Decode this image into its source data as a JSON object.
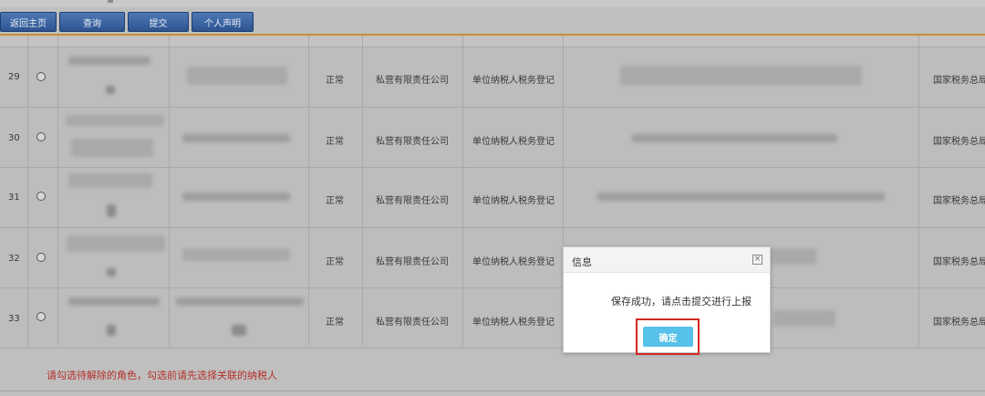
{
  "toolbar": {
    "home_label": "返回主页",
    "query_label": "查询",
    "submit_label": "提交",
    "declaration_label": "个人声明"
  },
  "table": {
    "rows": [
      {
        "no": "29",
        "status": "正常",
        "type": "私营有限责任公司",
        "registration": "单位纳税人税务登记",
        "authority": "国家税务总局"
      },
      {
        "no": "30",
        "status": "正常",
        "type": "私营有限责任公司",
        "registration": "单位纳税人税务登记",
        "authority": "国家税务总局"
      },
      {
        "no": "31",
        "status": "正常",
        "type": "私营有限责任公司",
        "registration": "单位纳税人税务登记",
        "authority": "国家税务总局"
      },
      {
        "no": "32",
        "status": "正常",
        "type": "私营有限责任公司",
        "registration": "单位纳税人税务登记",
        "authority": "国家税务总局"
      },
      {
        "no": "33",
        "status": "正常",
        "type": "私营有限责任公司",
        "registration": "单位纳税人税务登记",
        "authority": "国家税务总局"
      }
    ]
  },
  "hint": "请勾选待解除的角色，勾选前请先选择关联的纳税人",
  "dialog": {
    "title": "信息",
    "close_symbol": "×",
    "message": "保存成功，请点击提交进行上报",
    "ok_label": "确定"
  },
  "colors": {
    "toolbar_button": "#2d5490",
    "accent_line": "#c78f35",
    "hint_text": "#b5302a",
    "ok_button": "#56c1ea",
    "highlight_box": "#d32a22"
  }
}
